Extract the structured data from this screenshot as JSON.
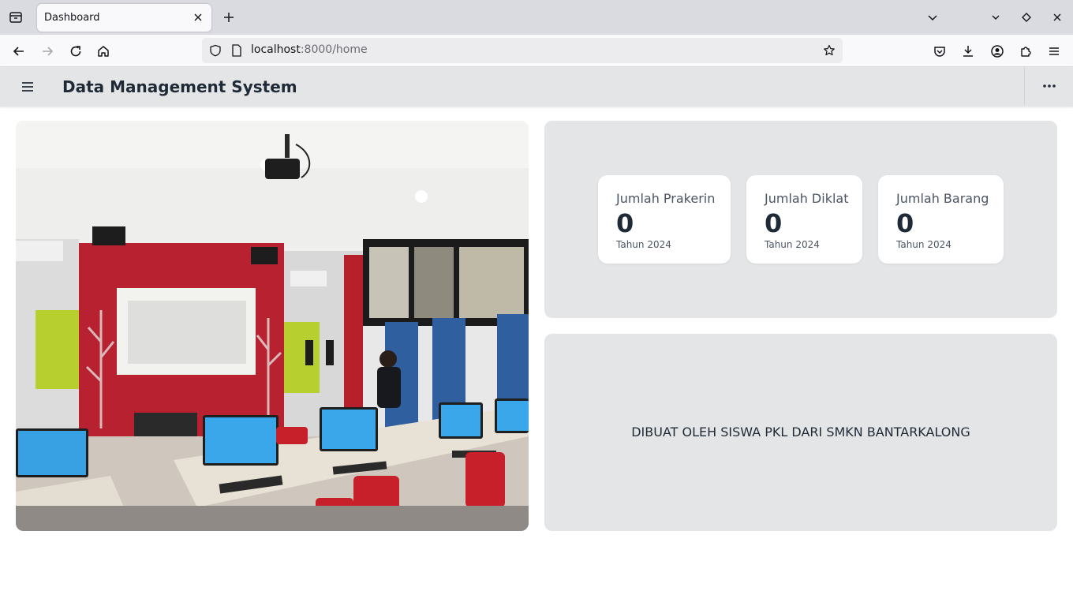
{
  "browser": {
    "tab_title": "Dashboard",
    "url_host": "localhost",
    "url_path": ":8000/home"
  },
  "app": {
    "title": "Data Management System"
  },
  "stats": [
    {
      "label": "Jumlah Prakerin",
      "value": "0",
      "year": "Tahun 2024"
    },
    {
      "label": "Jumlah Diklat",
      "value": "0",
      "year": "Tahun 2024"
    },
    {
      "label": "Jumlah Barang",
      "value": "0",
      "year": "Tahun 2024"
    }
  ],
  "footer_note": "DIBUAT OLEH SISWA PKL DARI SMKN BANTARKALONG",
  "icons": {
    "tab_list": "tab-list-icon",
    "tab_close": "close-icon",
    "new_tab": "plus-icon",
    "back": "back-arrow-icon",
    "forward": "forward-arrow-icon",
    "reload": "reload-icon",
    "home": "home-icon",
    "shield": "shield-icon",
    "page": "page-icon",
    "bookmark": "star-icon",
    "pocket": "pocket-icon",
    "downloads": "download-icon",
    "account": "account-icon",
    "extensions": "extensions-icon",
    "app_menu": "hamburger-menu-icon",
    "sidebar_toggle": "hamburger-menu-icon",
    "more": "more-dots-icon"
  },
  "colors": {
    "header_bg": "#e4e5e6",
    "card_bg": "#ffffff",
    "text_dark": "#1f2a37"
  }
}
